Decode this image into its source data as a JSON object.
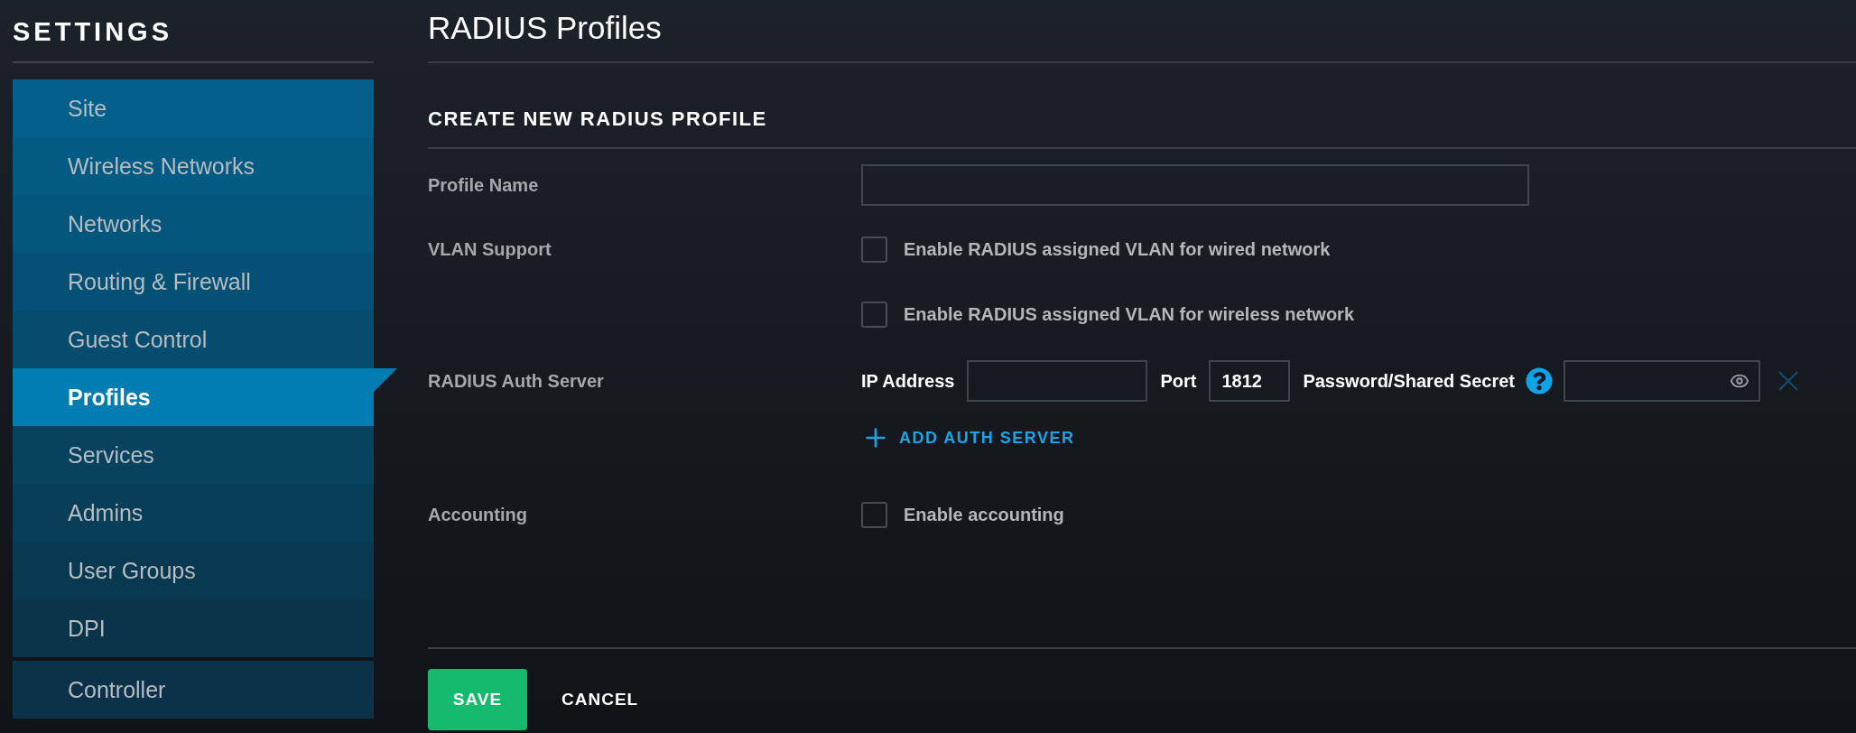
{
  "sidebar": {
    "title": "SETTINGS",
    "items": [
      {
        "label": "Site",
        "selected": false
      },
      {
        "label": "Wireless Networks",
        "selected": false
      },
      {
        "label": "Networks",
        "selected": false
      },
      {
        "label": "Routing & Firewall",
        "selected": false
      },
      {
        "label": "Guest Control",
        "selected": false
      },
      {
        "label": "Profiles",
        "selected": true
      },
      {
        "label": "Services",
        "selected": false
      },
      {
        "label": "Admins",
        "selected": false
      },
      {
        "label": "User Groups",
        "selected": false
      },
      {
        "label": "DPI",
        "selected": false
      }
    ],
    "lower_items": [
      {
        "label": "Controller",
        "selected": false
      }
    ]
  },
  "page_title": "RADIUS Profiles",
  "form": {
    "heading": "CREATE NEW RADIUS PROFILE",
    "profile_name": {
      "label": "Profile Name"
    },
    "vlan_support": {
      "label": "VLAN Support",
      "options": [
        {
          "label": "Enable RADIUS assigned VLAN for wired network",
          "checked": false
        },
        {
          "label": "Enable RADIUS assigned VLAN for wireless network",
          "checked": false
        }
      ]
    },
    "auth_server": {
      "label": "RADIUS Auth Server",
      "ip_label": "IP Address",
      "port_label": "Port",
      "port_value": "1812",
      "secret_label": "Password/Shared Secret",
      "add_link": "ADD AUTH SERVER"
    },
    "accounting": {
      "label": "Accounting",
      "option": {
        "label": "Enable accounting",
        "checked": false
      }
    }
  },
  "buttons": {
    "save": "SAVE",
    "cancel": "CANCEL"
  }
}
